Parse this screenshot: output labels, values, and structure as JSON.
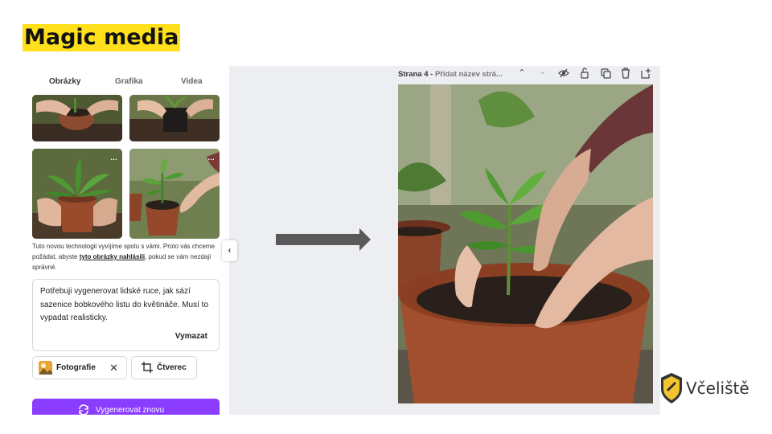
{
  "slide_title": "Magic media",
  "panel": {
    "tabs": [
      "Obrázky",
      "Grafika",
      "Videa"
    ],
    "more_icon": "…",
    "disclaimer_before": "Tuto novou technologii vyvíjíme spolu s vámi. Proto vás chceme požádat, abyste ",
    "disclaimer_link": "tyto obrázky nahlásili",
    "disclaimer_after": ", pokud se vám nezdají správné.",
    "prompt_text": "Potřebuji vygenerovat lidské ruce, jak sází sazenice bobkového listu do květináče. Musí to vypadat realisticky.",
    "clear_label": "Vymazat",
    "style_chip": "Fotografie",
    "aspect_chip": "Čtverec",
    "regenerate_label": "Vygenerovat znovu"
  },
  "editor": {
    "page_name": "Strana 4 -",
    "page_title_placeholder": "Přidat název strá..."
  },
  "logo_text": "Včeliště",
  "colors": {
    "title_highlight": "#ffe01a",
    "button_purple": "#8b3dff",
    "arrow": "#595959"
  }
}
